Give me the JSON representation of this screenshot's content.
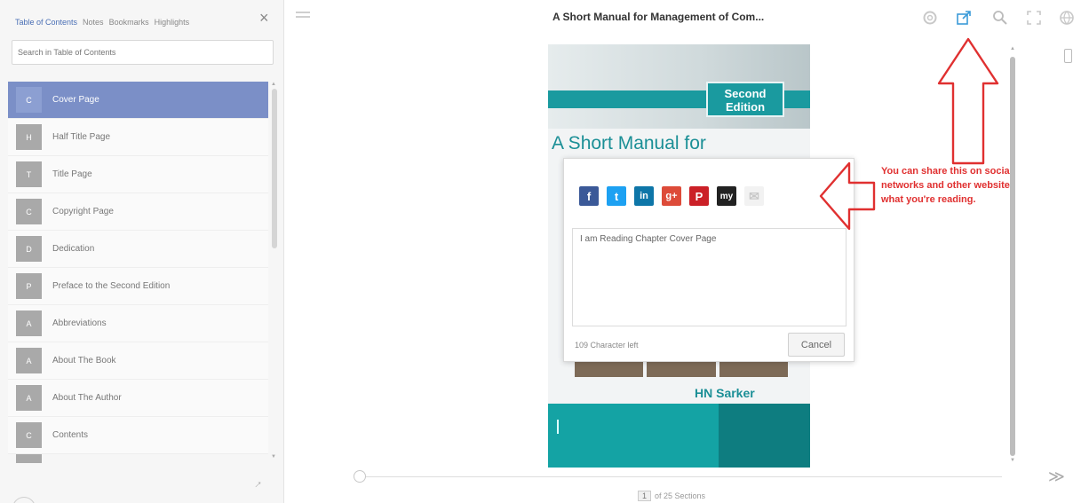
{
  "sidebar": {
    "tabs": [
      "Table of Contents",
      "Notes",
      "Bookmarks",
      "Highlights"
    ],
    "close_label": "×",
    "search_placeholder": "Search in Table of Contents",
    "toc": [
      {
        "badge": "C",
        "label": "Cover Page",
        "active": true
      },
      {
        "badge": "H",
        "label": "Half Title Page"
      },
      {
        "badge": "T",
        "label": "Title Page"
      },
      {
        "badge": "C",
        "label": "Copyright Page"
      },
      {
        "badge": "D",
        "label": "Dedication"
      },
      {
        "badge": "P",
        "label": "Preface to the Second Edition"
      },
      {
        "badge": "A",
        "label": "Abbreviations"
      },
      {
        "badge": "A",
        "label": "About The Book"
      },
      {
        "badge": "A",
        "label": "About The Author"
      },
      {
        "badge": "C",
        "label": "Contents"
      }
    ]
  },
  "header": {
    "title": "A Short Manual for Management of Com...",
    "icons": [
      "settings-icon",
      "share-icon",
      "search-icon",
      "fullscreen-icon",
      "globe-icon"
    ]
  },
  "cover": {
    "edition": "Second Edition",
    "title": "A Short Manual for",
    "author": "HN Sarker"
  },
  "share_popup": {
    "networks": [
      "facebook",
      "twitter",
      "linkedin",
      "google-plus",
      "pinterest",
      "myspace",
      "email"
    ],
    "network_glyphs": [
      "f",
      "t",
      "in",
      "g+",
      "P",
      "my",
      "✉"
    ],
    "message": "I am Reading Chapter Cover Page",
    "chars_left": "109 Character left",
    "cancel_label": "Cancel"
  },
  "annotation": {
    "text": "You can share this on social networks and other websites what you're reading."
  },
  "footer": {
    "current_page": "1",
    "total": "of 25 Sections"
  },
  "colors": {
    "accent": "#7b8fc7",
    "teal": "#14a3a4",
    "annotation_red": "#e03030",
    "share_active": "#3b9bd9"
  }
}
